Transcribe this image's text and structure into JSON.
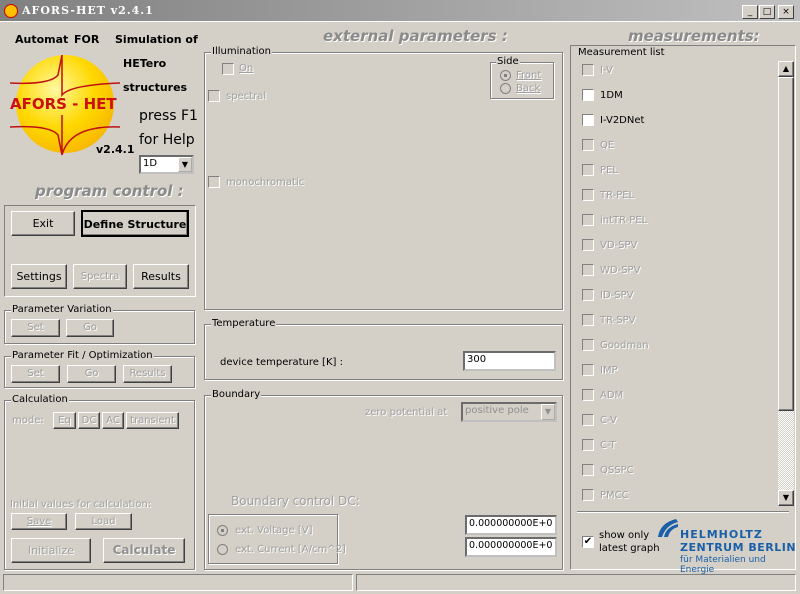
{
  "window": {
    "title": "AFORS-HET v2.4.1",
    "minimize": "_",
    "maximize": "□",
    "close": "×"
  },
  "logo": {
    "line1a": "Automat",
    "line1b": "FOR",
    "line1c": "Simulation of",
    "line2": "HETero",
    "line3": "structures",
    "logo_text": "AFORS - HET",
    "version": "v2.4.1",
    "help1": "press F1",
    "help2": "for Help",
    "dim_select": "1D"
  },
  "program_control": {
    "header": "program control :",
    "exit": "Exit",
    "define": "Define Structure",
    "settings": "Settings",
    "spectra": "Spectra",
    "results": "Results"
  },
  "param_variation": {
    "label": "Parameter Variation",
    "set": "Set",
    "go": "Go"
  },
  "param_fit": {
    "label": "Parameter Fit / Optimization",
    "set": "Set",
    "go": "Go",
    "results": "Results"
  },
  "calculation": {
    "label": "Calculation",
    "mode": "mode:",
    "eq": "Eq",
    "dc": "DC",
    "ac": "AC",
    "transient": "transient",
    "initial": "Initial values for calculation:",
    "save": "Save",
    "load": "Load",
    "initialize": "Initialize",
    "calculate": "Calculate"
  },
  "external": {
    "header": "external parameters :",
    "illumination": {
      "label": "Illumination",
      "on": "On",
      "spectral": "spectral",
      "monochromatic": "monochromatic",
      "side_label": "Side",
      "front": "Front",
      "back": "Back"
    },
    "temperature": {
      "label": "Temperature",
      "field_label": "device temperature [K] :",
      "value": "300"
    },
    "boundary": {
      "label": "Boundary",
      "zero_label": "zero potential at",
      "zero_value": "positive pole",
      "control_label": "Boundary control DC:",
      "voltage": "ext. Voltage [V]",
      "current": "ext. Current [A/cm^2]",
      "voltage_value": "0.000000000E+0",
      "current_value": "0.000000000E+0"
    }
  },
  "measurements": {
    "header": "measurements:",
    "list_label": "Measurement list",
    "items": [
      {
        "label": "I-V",
        "enabled": false
      },
      {
        "label": "1DM",
        "enabled": true
      },
      {
        "label": "I-V2DNet",
        "enabled": true
      },
      {
        "label": "QE",
        "enabled": false
      },
      {
        "label": "PEL",
        "enabled": false
      },
      {
        "label": "TR-PEL",
        "enabled": false
      },
      {
        "label": "intTR-PEL",
        "enabled": false
      },
      {
        "label": "VD-SPV",
        "enabled": false
      },
      {
        "label": "WD-SPV",
        "enabled": false
      },
      {
        "label": "ID-SPV",
        "enabled": false
      },
      {
        "label": "TR-SPV",
        "enabled": false
      },
      {
        "label": "Goodman",
        "enabled": false
      },
      {
        "label": "IMP",
        "enabled": false
      },
      {
        "label": "ADM",
        "enabled": false
      },
      {
        "label": "C-V",
        "enabled": false
      },
      {
        "label": "C-T",
        "enabled": false
      },
      {
        "label": "QSSPC",
        "enabled": false
      },
      {
        "label": "PMCC",
        "enabled": false
      }
    ],
    "show_only1": "show only",
    "show_only2": "latest graph",
    "show_only_checked": true,
    "hzb1": "HELMHOLTZ",
    "hzb2": "ZENTRUM BERLIN",
    "hzb3": "für Materialien und Energie"
  },
  "colors": {
    "logo_red": "#cc1010",
    "logo_yellow": "#ffd800",
    "hzb_blue": "#1a5fa8"
  }
}
